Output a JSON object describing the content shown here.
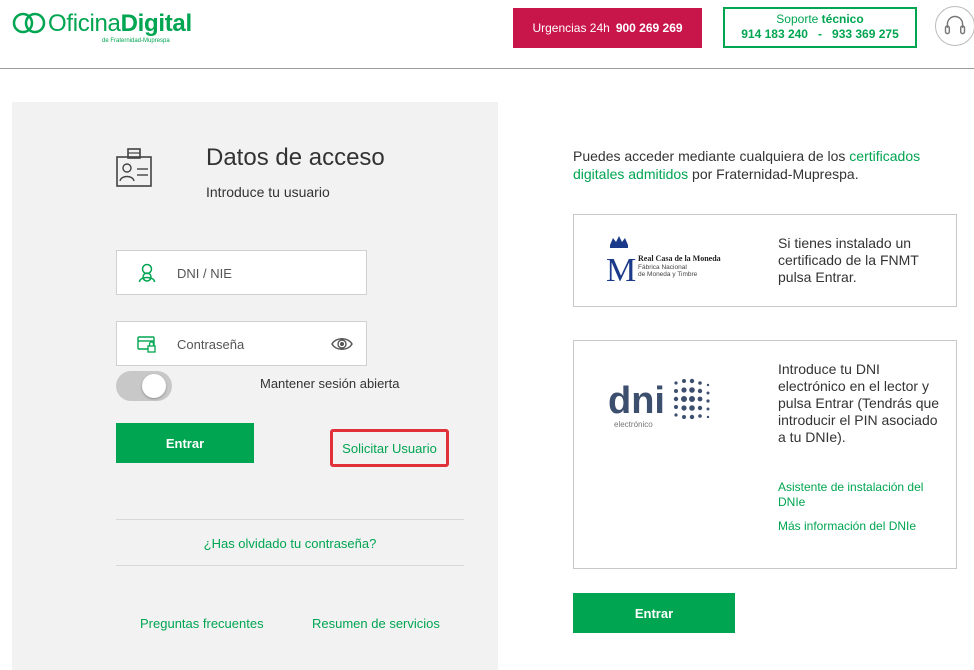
{
  "header": {
    "logo": {
      "word1": "Oficina",
      "word2": "Digital",
      "sub": "de Fraternidad-Muprespa"
    },
    "urgencias": {
      "label": "Urgencias 24h",
      "number": "900 269 269"
    },
    "soporte": {
      "line1_a": "Soporte",
      "line1_b": "técnico",
      "phone1": "914 183 240",
      "sep": "-",
      "phone2": "933 369 275"
    }
  },
  "login": {
    "title": "Datos de acceso",
    "subtitle": "Introduce tu usuario",
    "user_placeholder": "DNI / NIE",
    "pass_placeholder": "Contraseña",
    "keep_session": "Mantener sesión abierta",
    "enter_label": "Entrar",
    "request_user": "Solicitar Usuario",
    "forgot": "¿Has olvidado tu contraseña?",
    "faq": "Preguntas frecuentes",
    "services": "Resumen de servicios"
  },
  "right": {
    "intro_pre": "Puedes acceder mediante cualquiera de los ",
    "intro_link": "certificados digitales admitidos",
    "intro_post": " por Fraternidad-Muprespa.",
    "fnmt": {
      "logo_title": "Real Casa de la Moneda",
      "logo_sub1": "Fábrica Nacional",
      "logo_sub2": "de Moneda y Timbre",
      "text": "Si tienes instalado un certificado de la FNMT pulsa Entrar."
    },
    "dnie": {
      "logo_word": "dni",
      "logo_sub": "electrónico",
      "text": "Introduce tu DNI electrónico en el lector y pulsa Entrar (Tendrás que introducir el PIN asociado a tu DNIe).",
      "link1": "Asistente de instalación del DNIe",
      "link2": "Más información del DNIe"
    },
    "enter_label": "Entrar"
  },
  "colors": {
    "brand_green": "#00a551",
    "urgent": "#c8164b",
    "highlight": "#e0303a"
  }
}
